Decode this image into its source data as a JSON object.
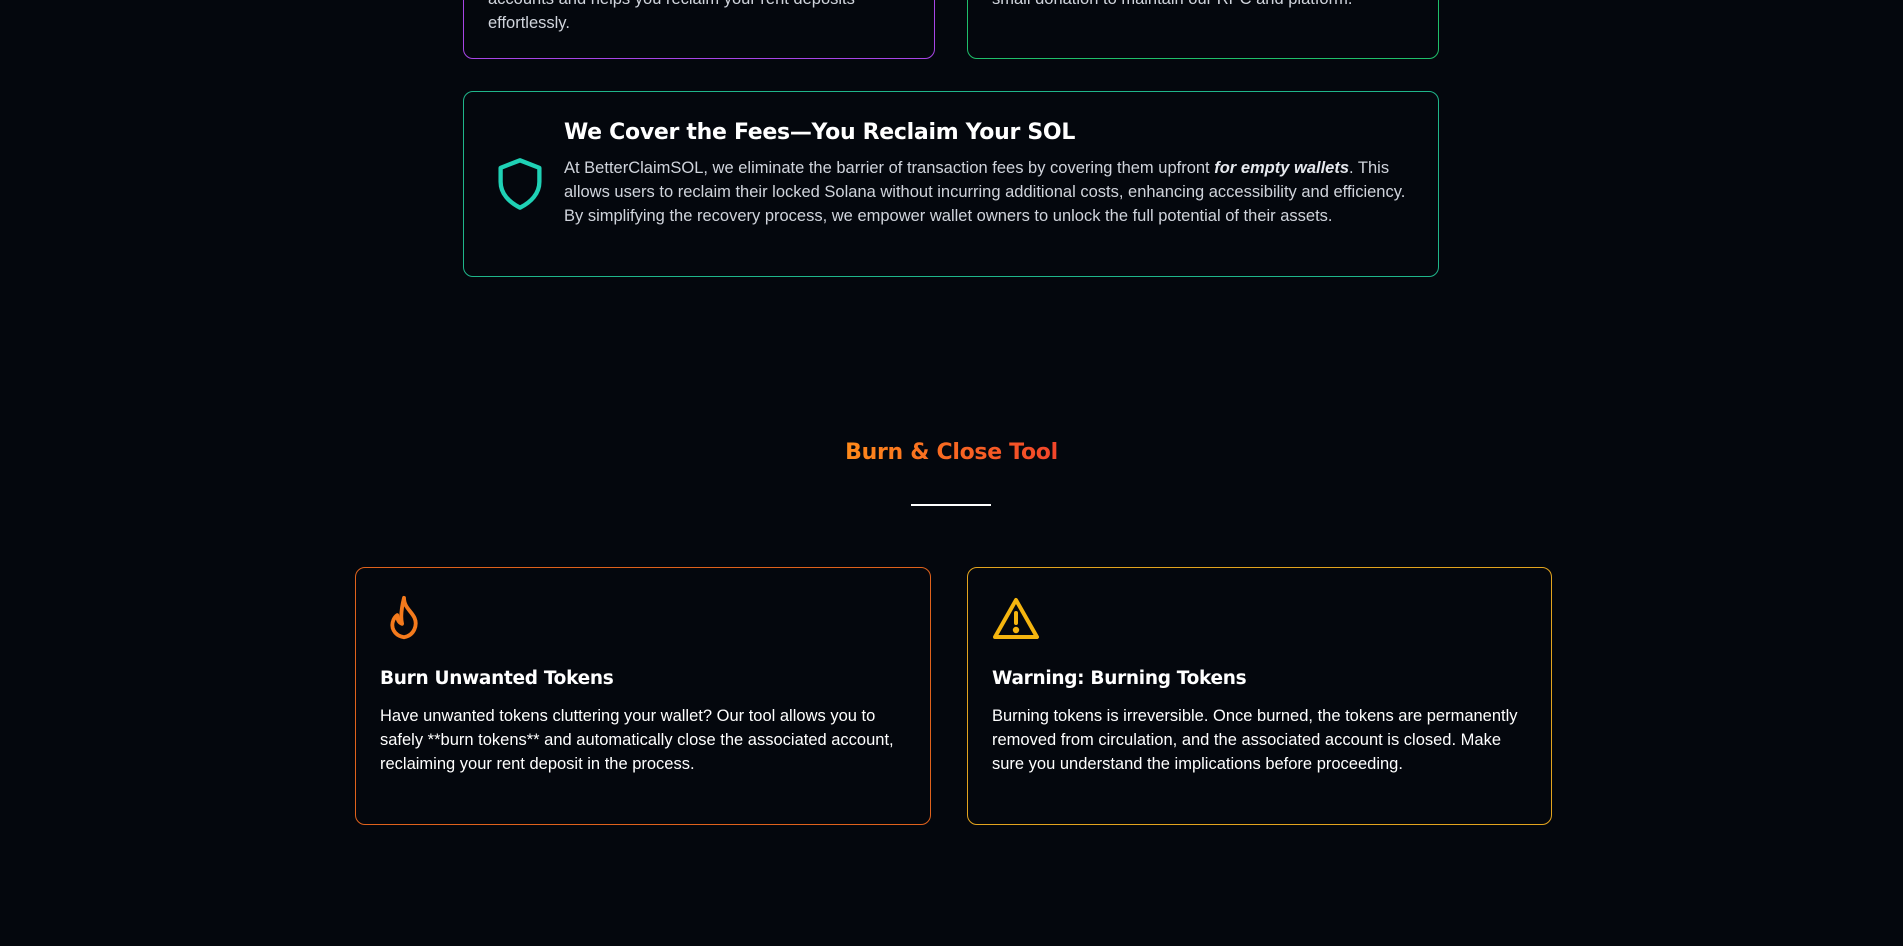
{
  "top_cards": {
    "left_text": "accounts and helps you reclaim your rent deposits effortlessly.",
    "right_text": "small donation to maintain our RPC and platform."
  },
  "fees_card": {
    "icon": "shield-icon",
    "title": "We Cover the Fees—You Reclaim Your SOL",
    "desc_before": "At BetterClaimSOL, we eliminate the barrier of transaction fees by covering them upfront ",
    "desc_emphasis": "for empty wallets",
    "desc_after": ". This allows users to reclaim their locked Solana without incurring additional costs, enhancing accessibility and efficiency. By simplifying the recovery process, we empower wallet owners to unlock the full potential of their assets.",
    "border_color": "#1fb58a",
    "icon_color": "#1fd1b5"
  },
  "burn_section": {
    "title": "Burn & Close Tool",
    "title_colors": [
      "#ff8a1a",
      "#f2452a"
    ],
    "cards": [
      {
        "icon": "flame-icon",
        "title": "Burn Unwanted Tokens",
        "text": "Have unwanted tokens cluttering your wallet? Our tool allows you to safely **burn tokens** and automatically close the associated account, reclaiming your rent deposit in the process.",
        "border_color": "#e0621c",
        "icon_color": "#f47a1c"
      },
      {
        "icon": "warning-icon",
        "title": "Warning: Burning Tokens",
        "text": "Burning tokens is irreversible. Once burned, the tokens are permanently removed from circulation, and the associated account is closed. Make sure you understand the implications before proceeding.",
        "border_color": "#e3a41e",
        "icon_color": "#f5b50f"
      }
    ]
  }
}
